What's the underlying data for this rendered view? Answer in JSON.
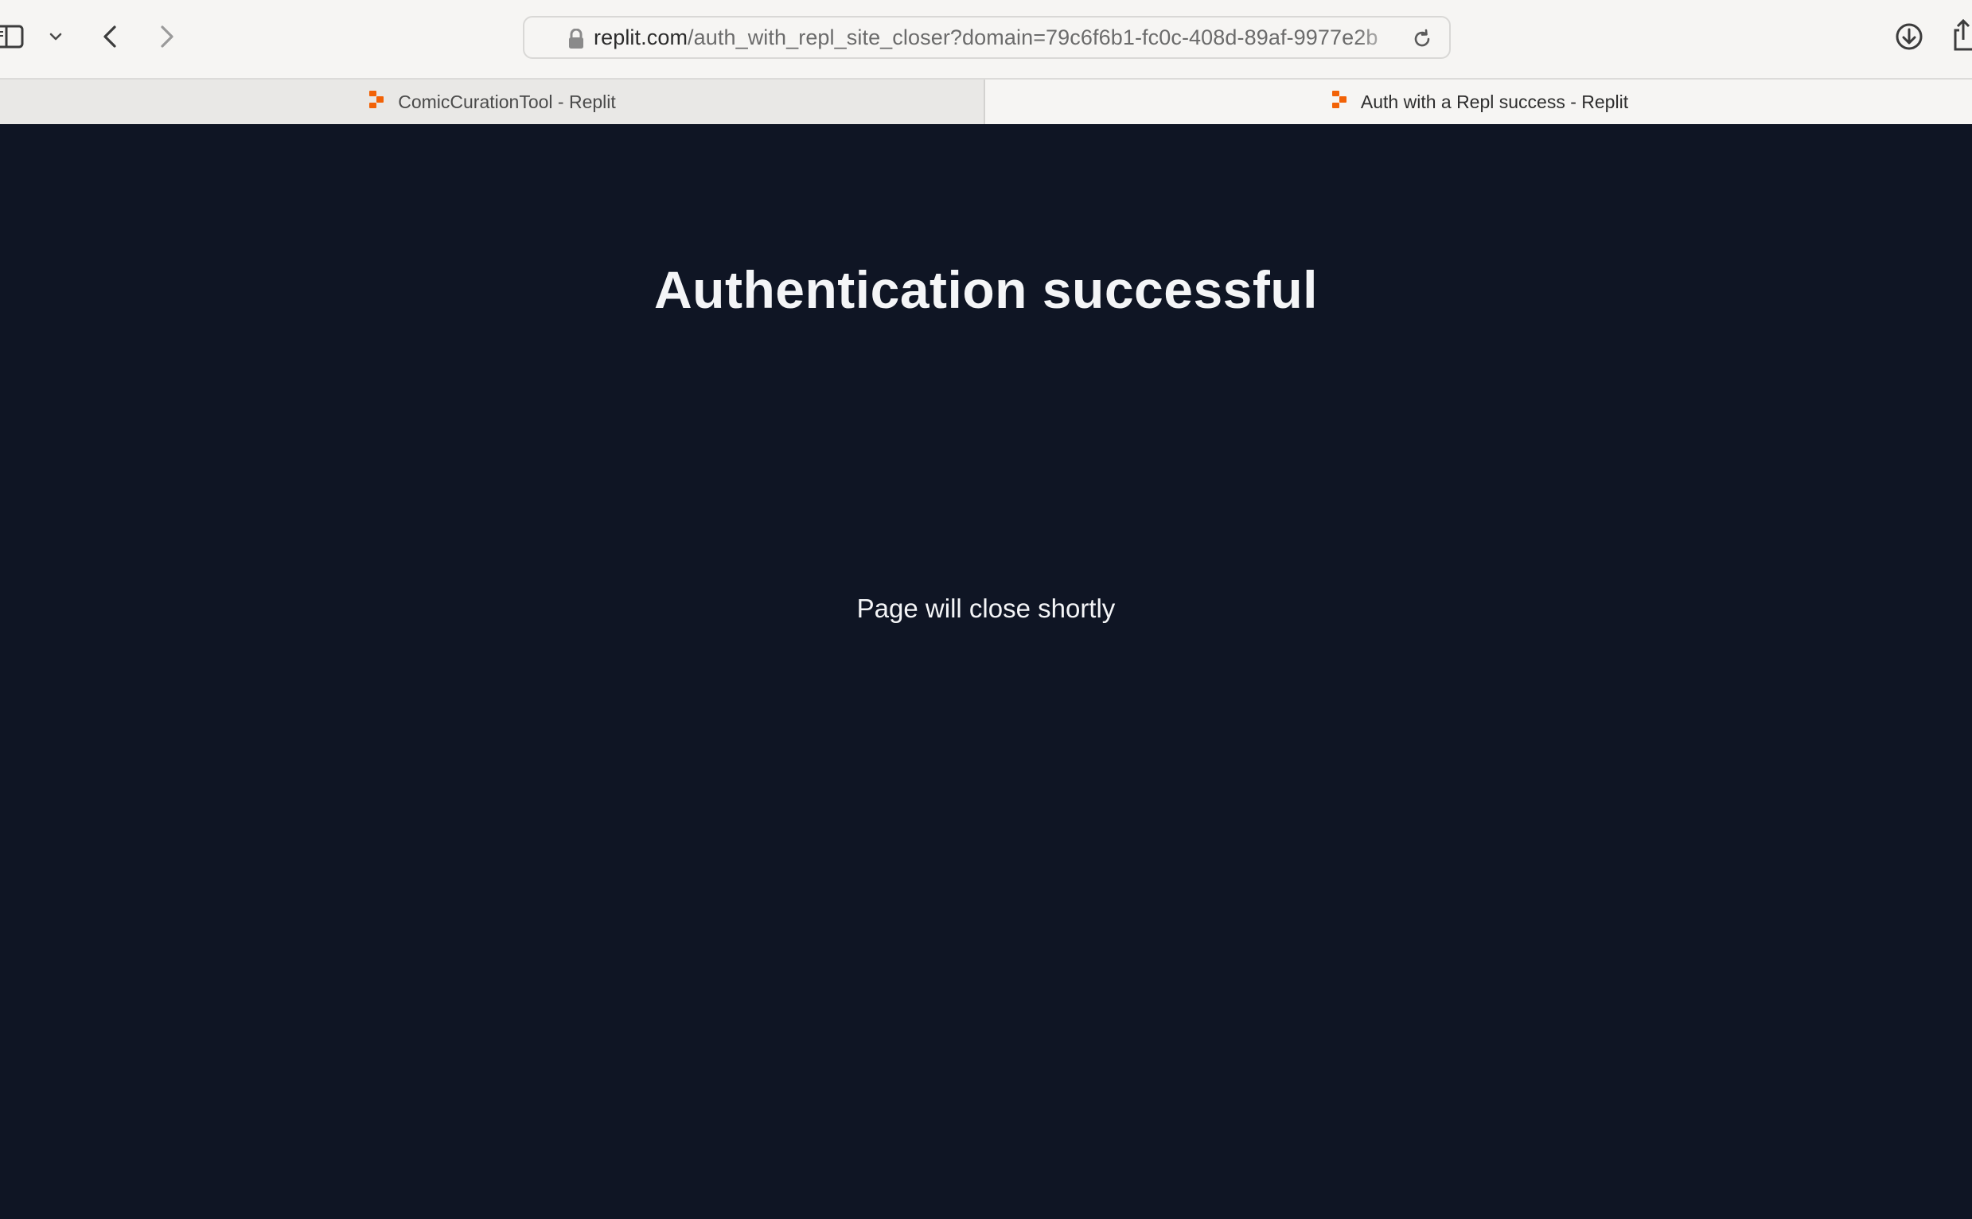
{
  "browser": {
    "url_host": "replit.com",
    "url_path": "/auth_with_repl_site_closer?domain=79c6f6b1-fc0c-408d-89af-9977e2b",
    "icons": {
      "sidebar": "sidebar-icon",
      "tab_overview": "chevron-down-icon",
      "back": "chevron-left-icon",
      "forward": "chevron-right-icon",
      "lock": "lock-icon",
      "reload": "reload-icon",
      "downloads": "download-icon",
      "share": "share-icon"
    }
  },
  "tabs": [
    {
      "label": "ComicCurationTool - Replit",
      "active": false
    },
    {
      "label": "Auth with a Repl success - Replit",
      "active": true
    }
  ],
  "page": {
    "heading": "Authentication successful",
    "message": "Page will close shortly"
  },
  "colors": {
    "page_background": "#0f1524",
    "text": "#f4f5f7",
    "favicon": "#f26207"
  }
}
